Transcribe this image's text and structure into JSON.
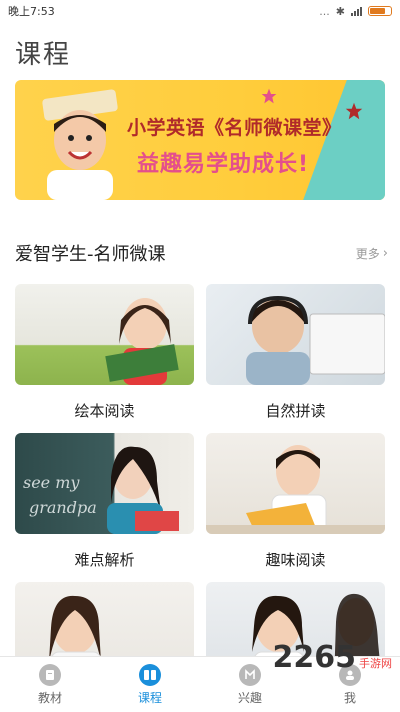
{
  "status": {
    "time": "晚上7:53",
    "icons": "...",
    "battery_color": "#e07a1f"
  },
  "page_title": "课程",
  "banner": {
    "line1": "小学英语《名师微课堂》",
    "line2": "益趣易学助成长!"
  },
  "section": {
    "title": "爱智学生-名师微课",
    "more": "更多"
  },
  "cards": [
    {
      "label": "绘本阅读"
    },
    {
      "label": "自然拼读"
    },
    {
      "label": "难点解析"
    },
    {
      "label": "趣味阅读"
    },
    {
      "label": ""
    },
    {
      "label": ""
    }
  ],
  "nav": {
    "items": [
      {
        "label": "教材",
        "icon": "book-icon"
      },
      {
        "label": "课程",
        "icon": "course-icon"
      },
      {
        "label": "兴趣",
        "icon": "interest-icon"
      },
      {
        "label": "我",
        "icon": "profile-icon"
      }
    ],
    "active_color": "#1a8fdb"
  },
  "watermark": {
    "number": "2265",
    "site": "手游网"
  }
}
